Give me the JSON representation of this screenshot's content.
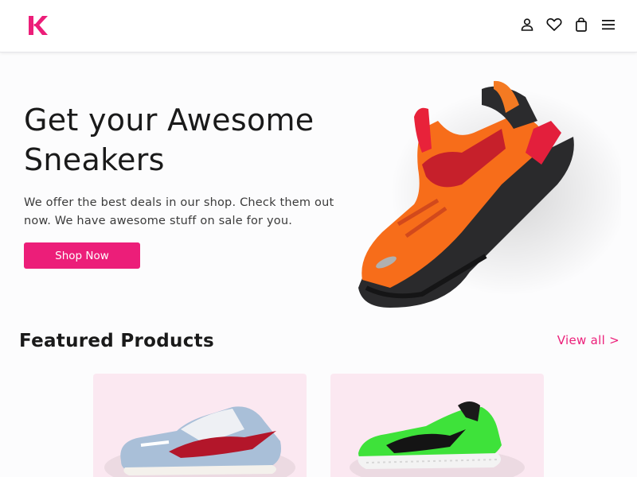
{
  "brand": {
    "logo_letter": "K",
    "accent": "#ec1e79"
  },
  "header": {
    "icons": [
      "user-icon",
      "heart-icon",
      "shopping-bag-icon",
      "menu-icon"
    ]
  },
  "hero": {
    "title_line1": "Get your Awesome",
    "title_line2": "Sneakers",
    "description": "We offer the best deals in our shop. Check them out now. We have awesome stuff on sale for you.",
    "cta_label": "Shop Now",
    "image": "orange-sneaker"
  },
  "featured": {
    "title": "Featured Products",
    "view_all_label": "View all >",
    "products": [
      {
        "image": "blue-red-low-sneaker"
      },
      {
        "image": "green-tennis-sneaker"
      }
    ]
  }
}
